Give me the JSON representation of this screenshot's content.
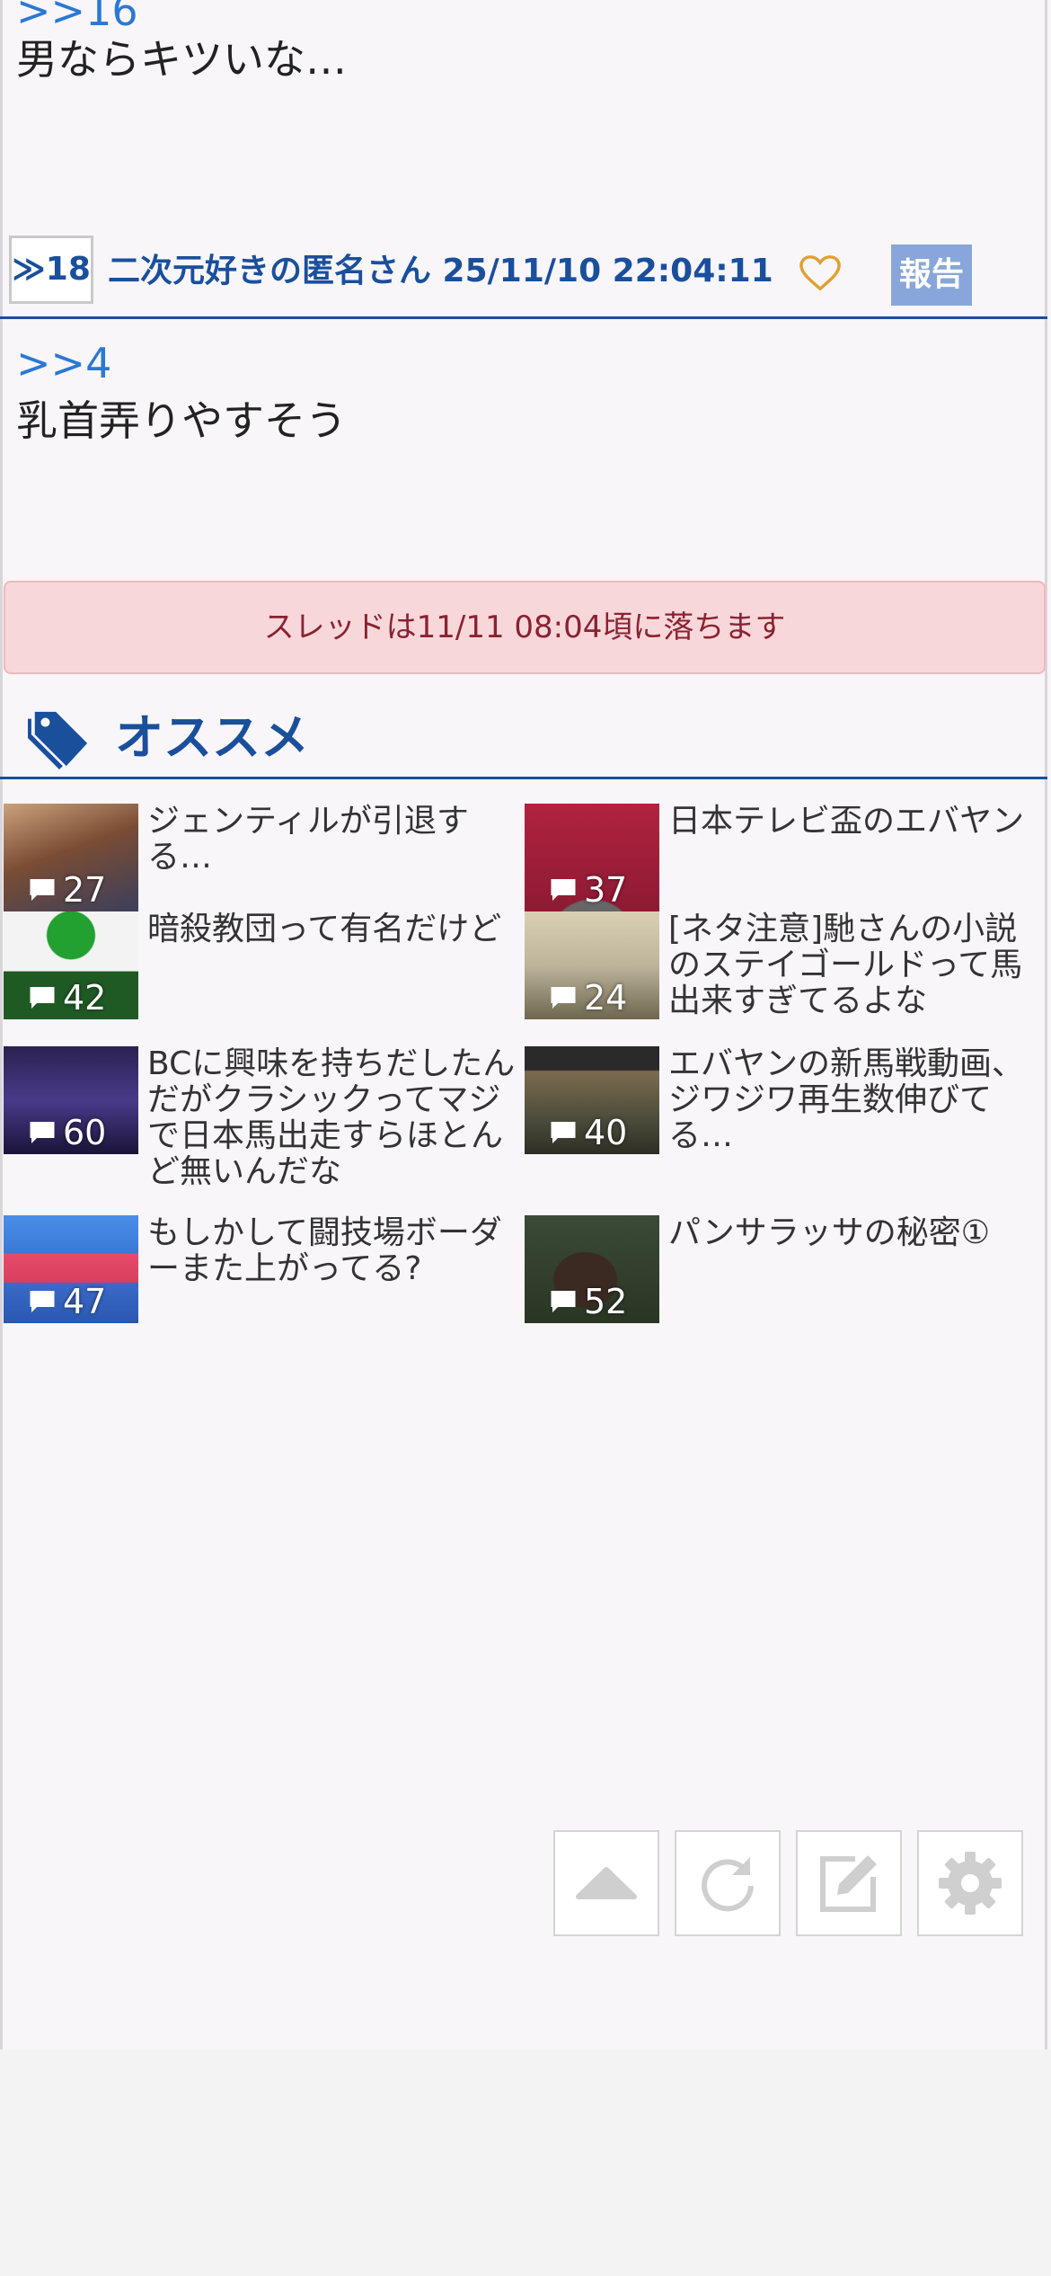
{
  "post_prev": {
    "anchor": ">>16",
    "text": "男ならキツいな…"
  },
  "res18": {
    "number": "≫18",
    "author_date": "二次元好きの匿名さん 25/11/10 22:04:11",
    "report_label": "報告",
    "anchor": ">>4",
    "text": "乳首弄りやすそう"
  },
  "notice": {
    "text": "スレッドは11/11 08:04頃に落ちます"
  },
  "recommend": {
    "title": "オススメ",
    "items": [
      {
        "title": "ジェンティルが引退する…",
        "count": "27",
        "thumb_color": "#6a4a3a"
      },
      {
        "title": "日本テレビ盃のエバヤン",
        "count": "37",
        "thumb_color": "#a8213a"
      },
      {
        "title": "暗殺教団って有名だけど",
        "count": "42",
        "thumb_color": "#2c8a3a"
      },
      {
        "title": "[ネタ注意]馳さんの小説のステイゴールドって馬出来すぎてるよな",
        "count": "24",
        "thumb_color": "#bfb8a4"
      },
      {
        "title": "BCに興味を持ちだしたんだがクラシックってマジで日本馬出走すらほとんど無いんだな",
        "count": "60",
        "thumb_color": "#3a2e6e"
      },
      {
        "title": "エバヤンの新馬戦動画、ジワジワ再生数伸びてる…",
        "count": "40",
        "thumb_color": "#5a5a4a"
      },
      {
        "title": "もしかして闘技場ボーダーまた上がってる?",
        "count": "47",
        "thumb_color": "#3d7ad6"
      },
      {
        "title": "パンサラッサの秘密①",
        "count": "52",
        "thumb_color": "#33402e"
      }
    ]
  },
  "toolbar": {
    "buttons": [
      "scroll-top",
      "reload",
      "write",
      "settings"
    ]
  },
  "colors": {
    "accent": "#1a4f9c",
    "anchor": "#2b78d4",
    "notice_bg": "#f8d7da",
    "report_bg": "#88a6da"
  }
}
